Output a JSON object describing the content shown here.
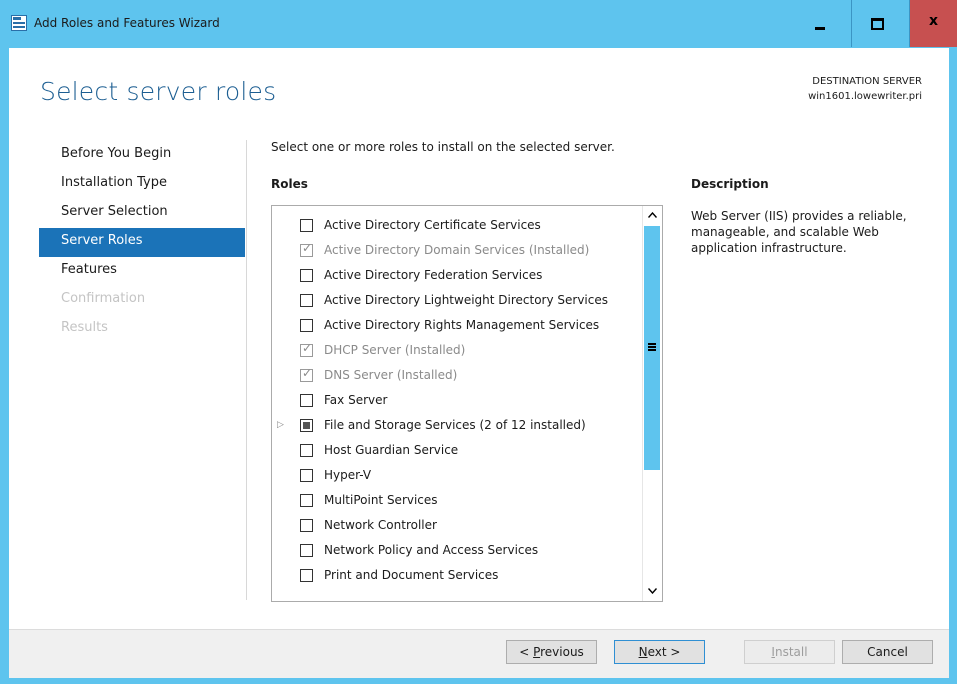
{
  "window": {
    "title": "Add Roles and Features Wizard",
    "close_glyph": "x",
    "accent_color": "#5ec4ee",
    "close_color": "#c75050"
  },
  "header": {
    "page_title": "Select server roles",
    "destination_label": "DESTINATION SERVER",
    "destination_server": "win1601.lowewriter.pri"
  },
  "nav": {
    "items": [
      {
        "label": "Before You Begin",
        "state": "normal"
      },
      {
        "label": "Installation Type",
        "state": "normal"
      },
      {
        "label": "Server Selection",
        "state": "normal"
      },
      {
        "label": "Server Roles",
        "state": "active"
      },
      {
        "label": "Features",
        "state": "normal"
      },
      {
        "label": "Confirmation",
        "state": "disabled"
      },
      {
        "label": "Results",
        "state": "disabled"
      }
    ]
  },
  "main": {
    "instruction": "Select one or more roles to install on the selected server.",
    "roles_heading": "Roles",
    "roles": [
      {
        "label": "Active Directory Certificate Services",
        "checked": false,
        "installed": false
      },
      {
        "label": "Active Directory Domain Services (Installed)",
        "checked": true,
        "installed": true
      },
      {
        "label": "Active Directory Federation Services",
        "checked": false,
        "installed": false
      },
      {
        "label": "Active Directory Lightweight Directory Services",
        "checked": false,
        "installed": false
      },
      {
        "label": "Active Directory Rights Management Services",
        "checked": false,
        "installed": false
      },
      {
        "label": "DHCP Server (Installed)",
        "checked": true,
        "installed": true
      },
      {
        "label": "DNS Server (Installed)",
        "checked": true,
        "installed": true
      },
      {
        "label": "Fax Server",
        "checked": false,
        "installed": false
      },
      {
        "label": "File and Storage Services (2 of 12 installed)",
        "checked": "partial",
        "installed": false,
        "expandable": true
      },
      {
        "label": "Host Guardian Service",
        "checked": false,
        "installed": false
      },
      {
        "label": "Hyper-V",
        "checked": false,
        "installed": false
      },
      {
        "label": "MultiPoint Services",
        "checked": false,
        "installed": false
      },
      {
        "label": "Network Controller",
        "checked": false,
        "installed": false
      },
      {
        "label": "Network Policy and Access Services",
        "checked": false,
        "installed": false
      },
      {
        "label": "Print and Document Services",
        "checked": false,
        "installed": false
      }
    ],
    "description_heading": "Description",
    "description_text": "Web Server (IIS) provides a reliable, manageable, and scalable Web application infrastructure."
  },
  "footer": {
    "previous_prefix": "< ",
    "previous_accel": "P",
    "previous_rest": "revious",
    "next_accel": "N",
    "next_rest": "ext >",
    "install_accel": "I",
    "install_rest": "nstall",
    "cancel_label": "Cancel"
  }
}
